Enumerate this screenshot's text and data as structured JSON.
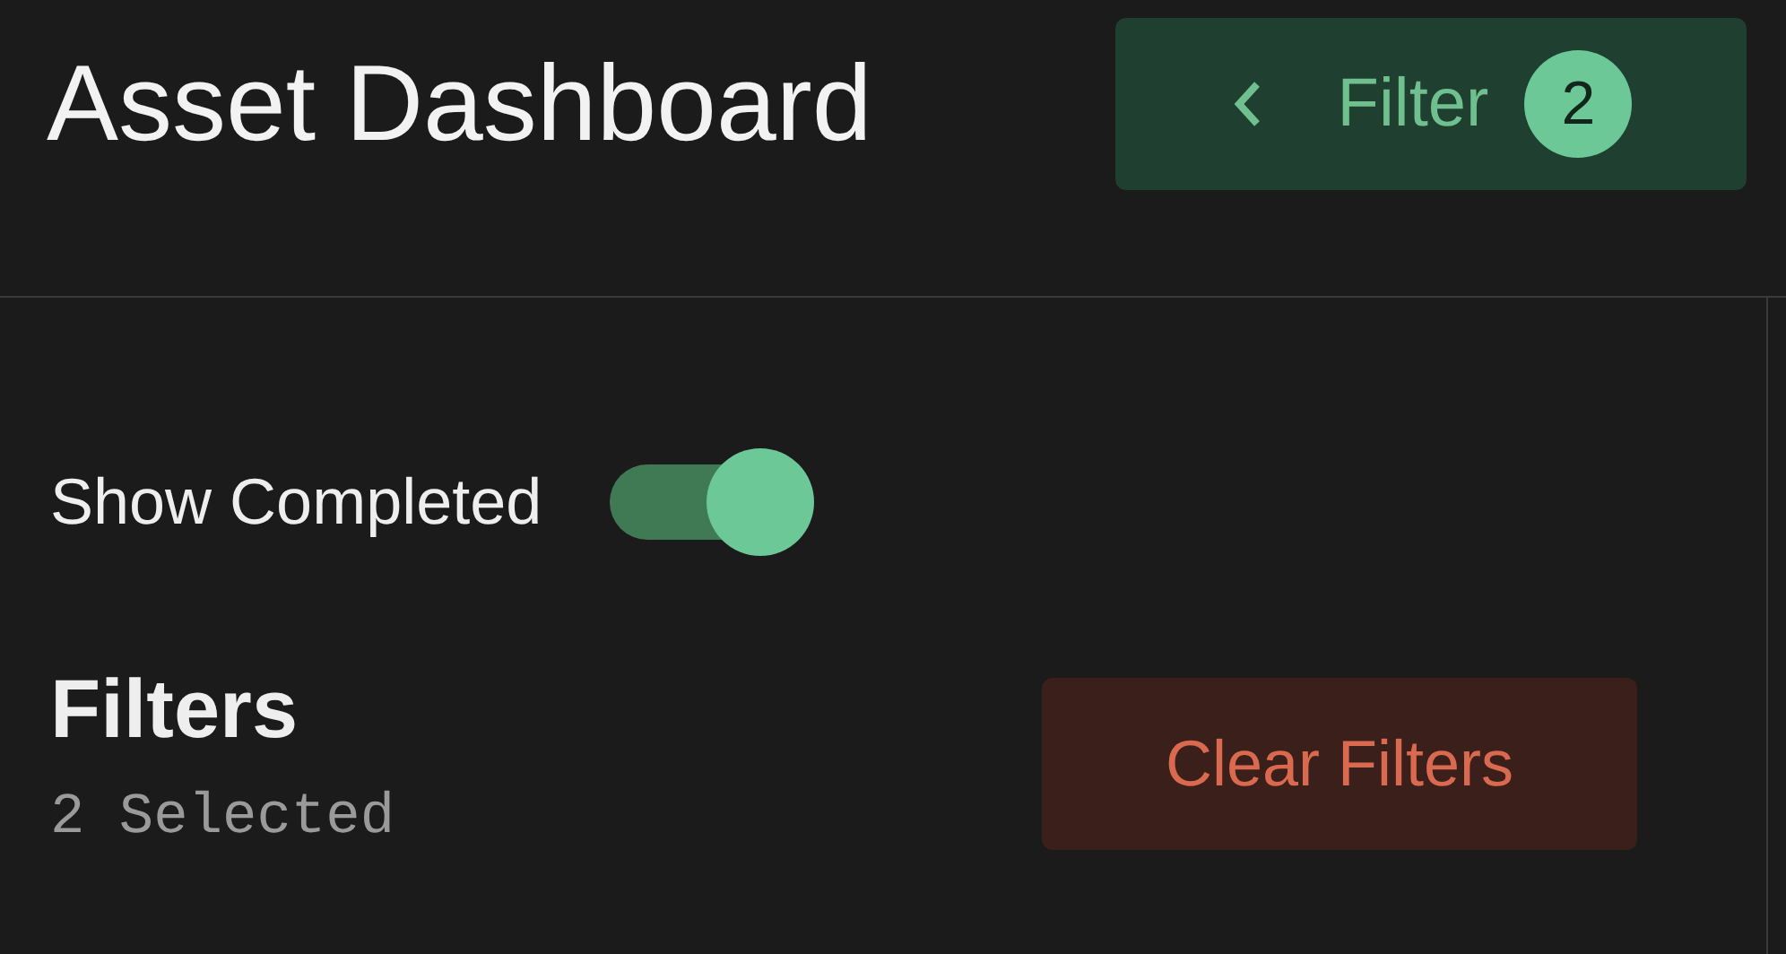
{
  "header": {
    "title": "Asset Dashboard",
    "filter_button": {
      "label": "Filter",
      "count": "2"
    }
  },
  "panel": {
    "show_completed": {
      "label": "Show Completed",
      "on": true
    },
    "filters": {
      "heading": "Filters",
      "summary": "2 Selected"
    },
    "clear_button": {
      "label": "Clear Filters"
    }
  }
}
